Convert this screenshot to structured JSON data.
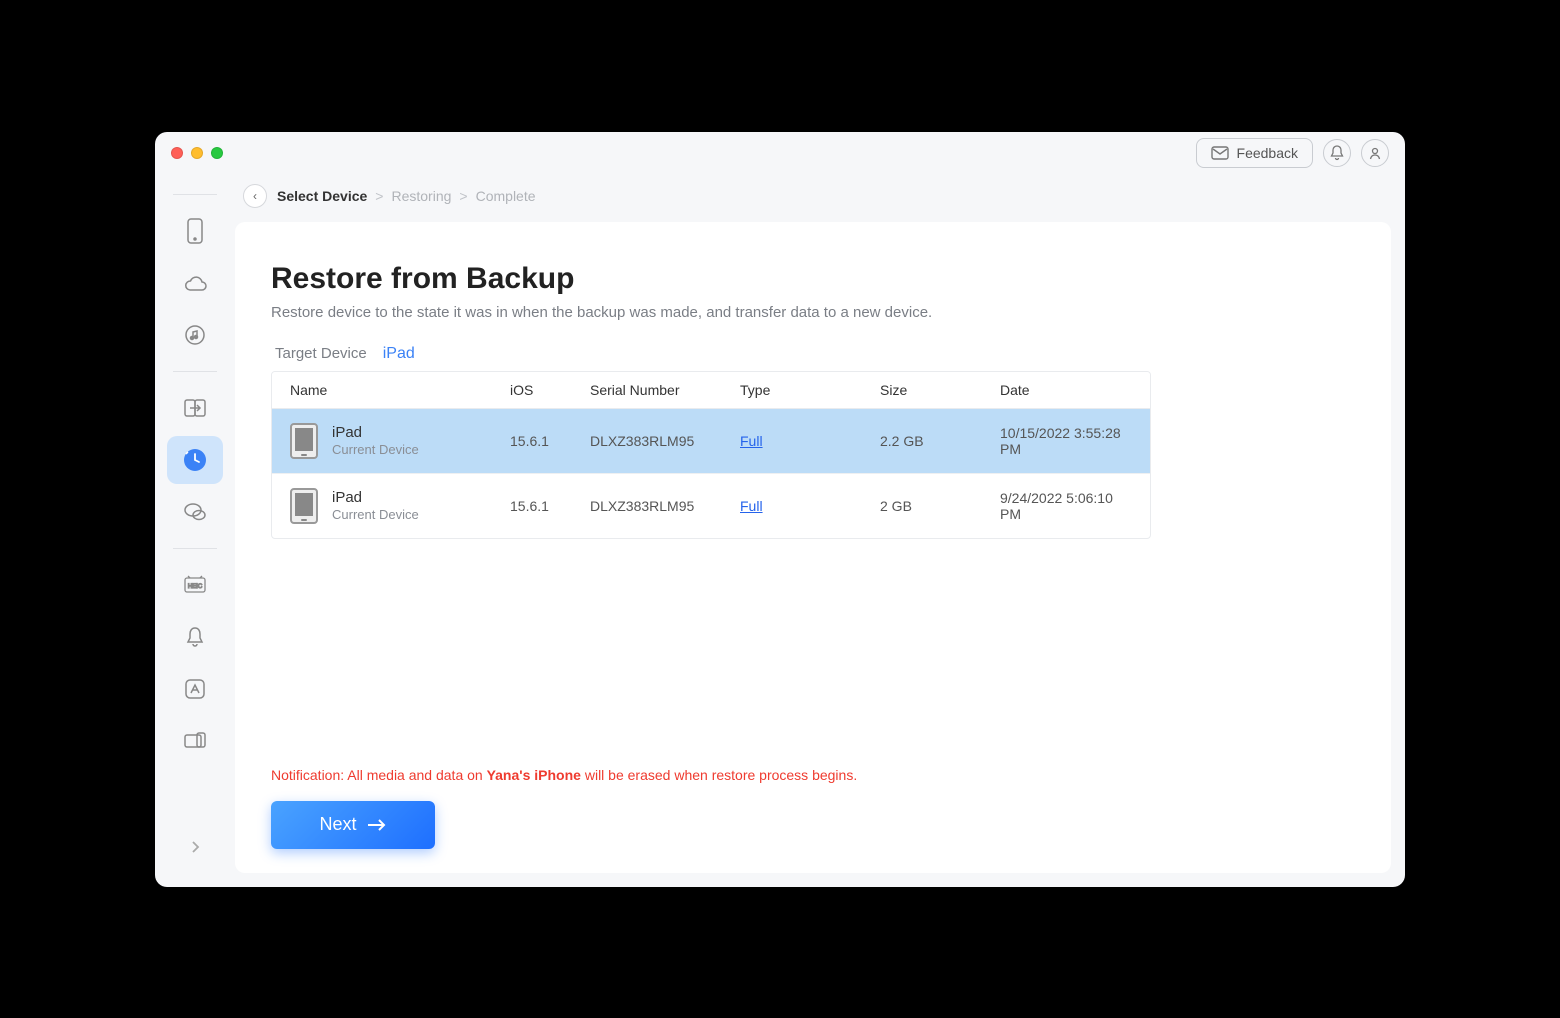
{
  "titlebar": {
    "feedback_label": "Feedback"
  },
  "breadcrumb": {
    "step1": "Select Device",
    "step2": "Restoring",
    "step3": "Complete"
  },
  "page": {
    "title": "Restore from Backup",
    "subtitle": "Restore device to the state it was in when the backup was made, and transfer data to a new device.",
    "target_label": "Target Device",
    "target_value": "iPad"
  },
  "table": {
    "headers": {
      "name": "Name",
      "ios": "iOS",
      "serial": "Serial Number",
      "type": "Type",
      "size": "Size",
      "date": "Date"
    },
    "rows": [
      {
        "device_name": "iPad",
        "device_caption": "Current Device",
        "ios": "15.6.1",
        "serial": "DLXZ383RLM95",
        "type": "Full",
        "size": "2.2 GB",
        "date": "10/15/2022 3:55:28 PM",
        "selected": true
      },
      {
        "device_name": "iPad",
        "device_caption": "Current Device",
        "ios": "15.6.1",
        "serial": "DLXZ383RLM95",
        "type": "Full",
        "size": "2 GB",
        "date": "9/24/2022 5:06:10 PM",
        "selected": false
      }
    ]
  },
  "notification": {
    "prefix": "Notification: All media and data on ",
    "bold": "Yana's iPhone",
    "suffix": " will be erased when restore process begins."
  },
  "actions": {
    "next": "Next"
  }
}
